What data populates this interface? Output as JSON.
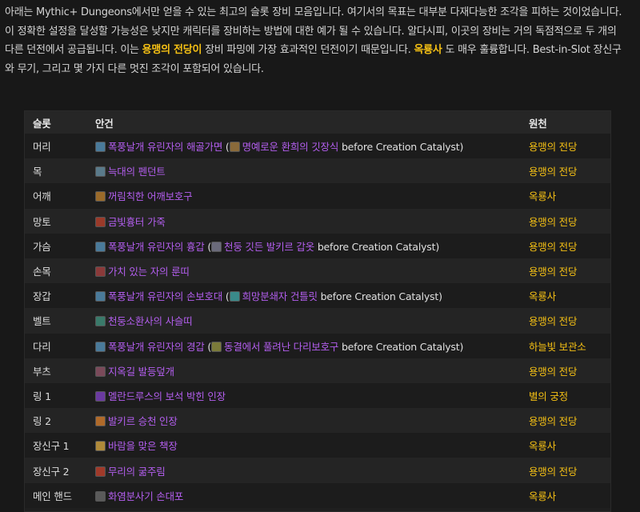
{
  "intro": {
    "text_before": "아래는 Mythic+ Dungeons에서만 얻을 수 있는 최고의 슬롯 장비 모음입니다. 여기서의 목표는 대부분 다재다능한 조각을 피하는 것이었습니다. 이 정확한 설정을 달성할 가능성은 낮지만 캐릭터를 장비하는 방법에 대한 예가 될 수 있습니다. 알다시피, 이곳의 장비는 거의 독점적으로 두 개의 다른 던전에서 공급됩니다. 이는 ",
    "highlight_1": "용맹의 전당이",
    "text_middle": " 장비 파밍에 가장 효과적인 던전이기 때문입니다. ",
    "highlight_2": "옥룡사",
    "text_after": " 도 매우 훌륭합니다. Best-in-Slot 장신구와 무기, 그리고 몇 가지 다른 멋진 조각이 포함되어 있습니다."
  },
  "table": {
    "headers": {
      "slot": "슬롯",
      "item": "안건",
      "source": "원천"
    },
    "rows": [
      {
        "slot": "머리",
        "item": "폭풍날개 유린자의 해골가면",
        "icon": "helm-icon",
        "icon_color": "#4a7a9a",
        "alt_open": " (",
        "alt_item": "명예로운 환희의 깃장식",
        "alt_icon": "feather-icon",
        "alt_icon_color": "#8a6a3a",
        "alt_tail": " before Creation Catalyst)",
        "source": "용맹의 전당"
      },
      {
        "slot": "목",
        "item": "늑대의 펜던트",
        "icon": "pendant-icon",
        "icon_color": "#5a7a8a",
        "source": "용맹의 전당"
      },
      {
        "slot": "어깨",
        "item": "꺼림칙한 어깨보호구",
        "icon": "shoulder-icon",
        "icon_color": "#9a6a2a",
        "source": "옥룡사"
      },
      {
        "slot": "망토",
        "item": "금빛흉터 가죽",
        "icon": "cloak-icon",
        "icon_color": "#9a3a2a",
        "source": "용맹의 전당"
      },
      {
        "slot": "가슴",
        "item": "폭풍날개 유린자의 흉갑",
        "icon": "chest-icon",
        "icon_color": "#4a7a9a",
        "alt_open": " (",
        "alt_item": "천둥 깃든 발키르 갑옷",
        "alt_icon": "armor-icon",
        "alt_icon_color": "#6a6a7a",
        "alt_tail": " before Creation Catalyst)",
        "source": "용맹의 전당"
      },
      {
        "slot": "손목",
        "item": "가치 있는 자의 룬띠",
        "icon": "bracer-icon",
        "icon_color": "#8a3a3a",
        "source": "용맹의 전당"
      },
      {
        "slot": "장갑",
        "item": "폭풍날개 유린자의 손보호대",
        "icon": "gloves-icon",
        "icon_color": "#4a7a9a",
        "alt_open": " (",
        "alt_item": "희망분쇄자 건틀릿",
        "alt_icon": "gauntlet-icon",
        "alt_icon_color": "#3a8a8a",
        "alt_tail": " before Creation Catalyst)",
        "source": "옥룡사"
      },
      {
        "slot": "벨트",
        "item": "천둥소환사의 사슬띠",
        "icon": "belt-icon",
        "icon_color": "#3a7a6a",
        "source": "용맹의 전당"
      },
      {
        "slot": "다리",
        "item": "폭풍날개 유린자의 경갑",
        "icon": "legs-icon",
        "icon_color": "#4a7a9a",
        "alt_open": " (",
        "alt_item": "동결에서 풀려난 다리보호구",
        "alt_icon": "leggings-icon",
        "alt_icon_color": "#7a7a3a",
        "alt_tail": " before Creation Catalyst)",
        "source": "하늘빛 보관소"
      },
      {
        "slot": "부츠",
        "item": "지옥길 발등덮개",
        "icon": "boots-icon",
        "icon_color": "#7a4a5a",
        "source": "용맹의 전당"
      },
      {
        "slot": "링 1",
        "item": "멜란드루스의 보석 박힌 인장",
        "icon": "ring-icon",
        "icon_color": "#6a3aa0",
        "source": "별의 궁정"
      },
      {
        "slot": "링 2",
        "item": "발키르 승천 인장",
        "icon": "ring-icon",
        "icon_color": "#b06a2a",
        "source": "용맹의 전당"
      },
      {
        "slot": "장신구 1",
        "item": "바람을 맞은 책장",
        "icon": "trinket-icon",
        "icon_color": "#b08a3a",
        "source": "옥룡사"
      },
      {
        "slot": "장신구 2",
        "item": "무리의 굶주림",
        "icon": "trinket-icon",
        "icon_color": "#a03a2a",
        "source": "용맹의 전당"
      },
      {
        "slot": "메인 핸드",
        "item": "화염분사기 손대포",
        "icon": "weapon-icon",
        "icon_color": "#5a5a5a",
        "source": "옥룡사"
      }
    ]
  }
}
